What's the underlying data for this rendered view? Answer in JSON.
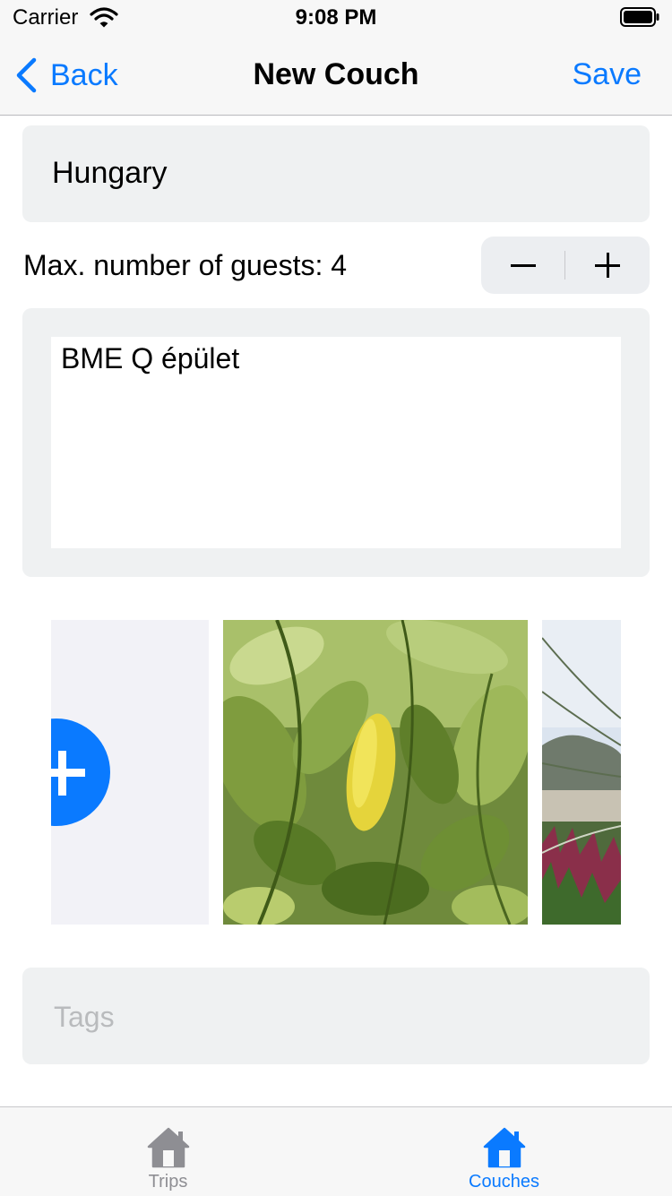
{
  "status_bar": {
    "carrier": "Carrier",
    "time": "9:08 PM",
    "wifi_icon": "wifi-icon",
    "battery_icon": "battery-icon"
  },
  "nav": {
    "back_label": "Back",
    "back_icon": "chevron-left-icon",
    "title": "New Couch",
    "save_label": "Save"
  },
  "form": {
    "country_value": "Hungary",
    "guests_label": "Max. number of guests: 4",
    "stepper": {
      "minus_icon": "minus-icon",
      "plus_icon": "plus-icon"
    },
    "address_value": "BME Q épület",
    "tags_placeholder": "Tags"
  },
  "gallery": {
    "add_icon": "add-photo-icon",
    "photos": [
      "photo-citrus-leaves",
      "photo-grass-coast"
    ]
  },
  "tab_bar": {
    "items": [
      {
        "label": "Trips",
        "icon": "house-icon",
        "selected": false
      },
      {
        "label": "Couches",
        "icon": "house-icon",
        "selected": true
      }
    ]
  },
  "colors": {
    "accent": "#0a7aff",
    "field_background": "#eff1f2",
    "inactive_tab": "#8e8e93",
    "placeholder": "#b9bbbd"
  }
}
